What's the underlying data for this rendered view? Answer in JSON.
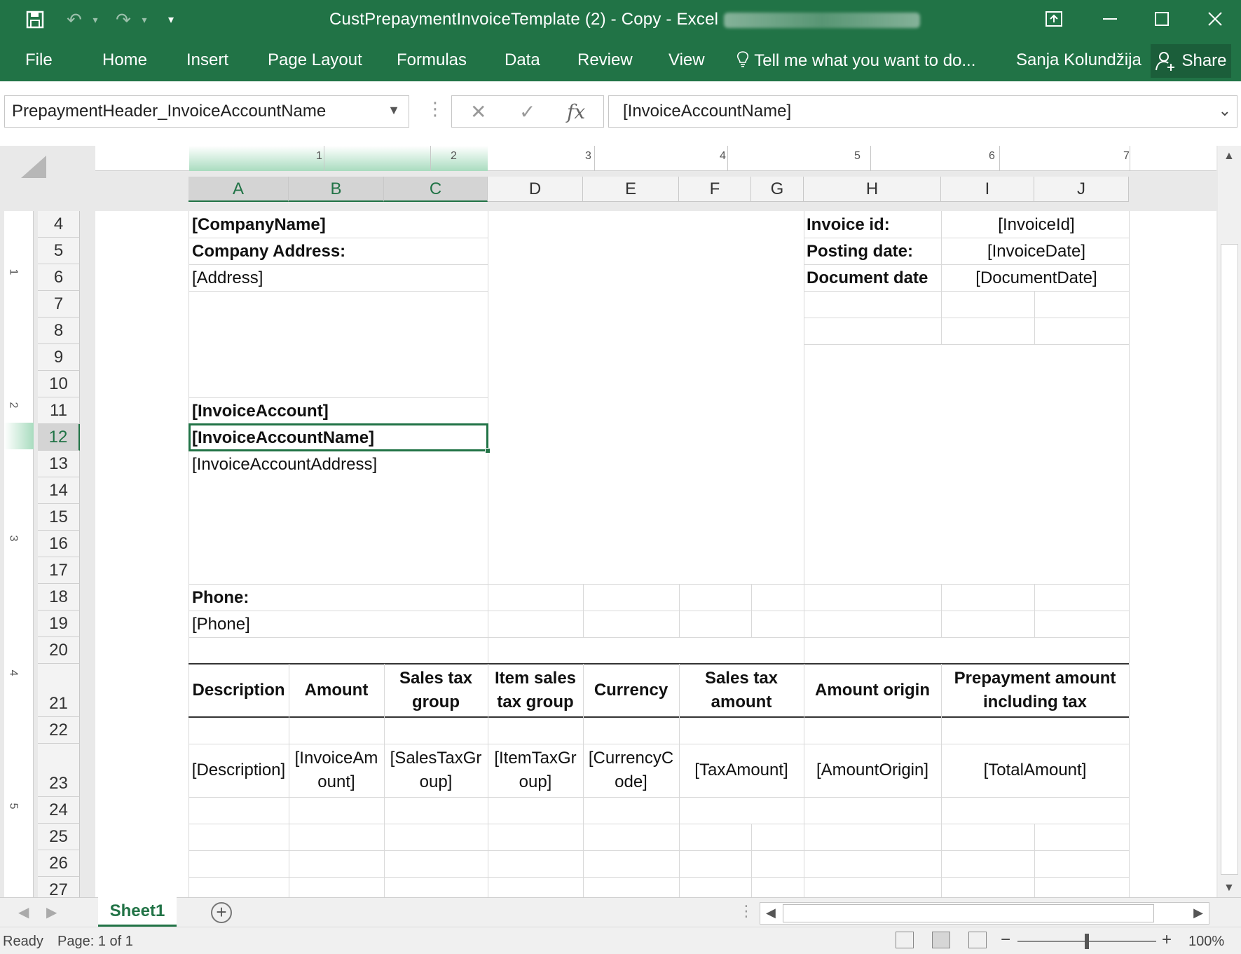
{
  "app": {
    "title": "CustPrepaymentInvoiceTemplate (2) - Copy - Excel",
    "accent": "#217346"
  },
  "title_icons": [
    "save-icon",
    "undo-icon",
    "redo-icon",
    "customize-quick-access-icon"
  ],
  "window_controls": [
    "ribbon-display-options-icon",
    "minimize-icon",
    "maximize-icon",
    "close-icon"
  ],
  "ribbon": {
    "tabs": [
      "File",
      "Home",
      "Insert",
      "Page Layout",
      "Formulas",
      "Data",
      "Review",
      "View"
    ],
    "tell_me": "Tell me what you want to do...",
    "user": "Sanja Kolundžija",
    "share": "Share"
  },
  "formula_bar": {
    "name_box": "PrepaymentHeader_InvoiceAccountName",
    "formula": "[InvoiceAccountName]",
    "cancel_glyph": "✕",
    "enter_glyph": "✓",
    "fx": "fx"
  },
  "ruler": {
    "top": [
      "1",
      "2",
      "3",
      "4",
      "5",
      "6",
      "7"
    ],
    "left": [
      "1",
      "2",
      "3",
      "4",
      "5"
    ]
  },
  "columns": [
    "A",
    "B",
    "C",
    "D",
    "E",
    "F",
    "G",
    "H",
    "I",
    "J"
  ],
  "rows": [
    "4",
    "5",
    "6",
    "7",
    "8",
    "9",
    "10",
    "11",
    "12",
    "13",
    "14",
    "15",
    "16",
    "17",
    "18",
    "19",
    "20",
    "21",
    "22",
    "23",
    "24",
    "25",
    "26",
    "27"
  ],
  "selected": {
    "column": "A",
    "row": "12"
  },
  "cells": {
    "company_name": "[CompanyName]",
    "company_address_label": "Company Address:",
    "address": "[Address]",
    "invoice_account": "[InvoiceAccount]",
    "invoice_account_name": "[InvoiceAccountName]",
    "invoice_account_address": "[InvoiceAccountAddress]",
    "phone_label": "Phone:",
    "phone": "[Phone]",
    "invoice_id_label": "Invoice id:",
    "invoice_id": "[InvoiceId]",
    "posting_date_label": "Posting date:",
    "posting_date": "[InvoiceDate]",
    "document_date_label": "Document date",
    "document_date": "[DocumentDate]"
  },
  "table": {
    "headers": [
      "Description",
      "Amount",
      "Sales tax group",
      "Item sales tax group",
      "Currency",
      "Sales tax amount",
      "Amount origin",
      "Prepayment amount including tax"
    ],
    "row": [
      "[Description]",
      "[InvoiceAmount]",
      "[SalesTaxGroup]",
      "[ItemTaxGroup]",
      "[CurrencyCode]",
      "[TaxAmount]",
      "[AmountOrigin]",
      "[TotalAmount]"
    ]
  },
  "sheet_tabs": [
    "Sheet1"
  ],
  "status": {
    "ready": "Ready",
    "page": "Page: 1 of 1",
    "zoom": "100%"
  }
}
